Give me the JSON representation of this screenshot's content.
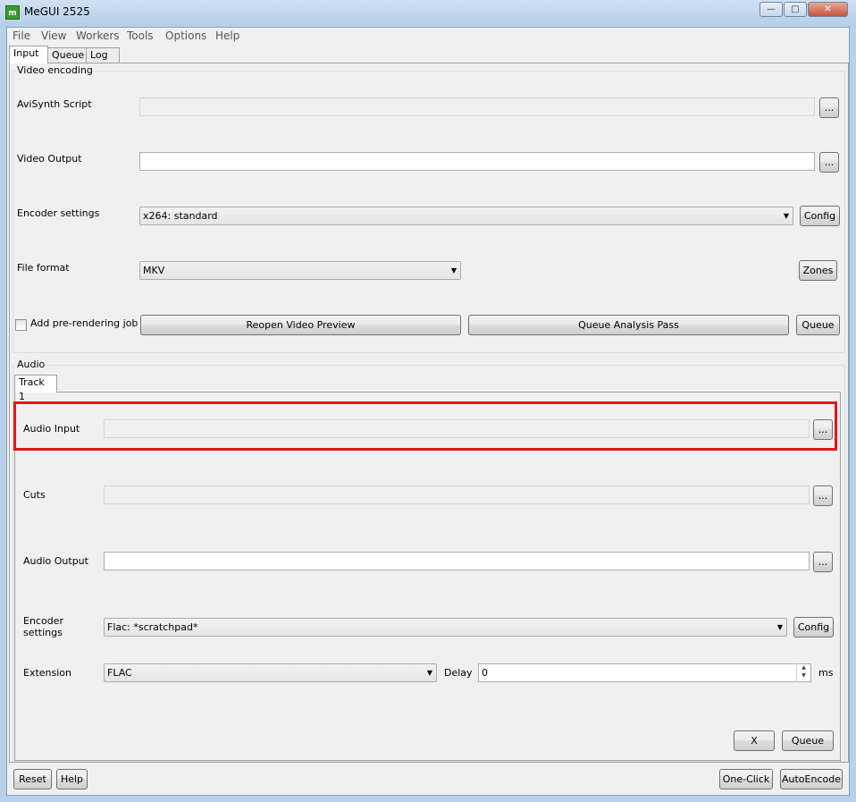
{
  "window": {
    "title": "MeGUI 2525",
    "icon_text": "m"
  },
  "menu": [
    "File",
    "View",
    "Workers",
    "Tools",
    "Options",
    "Help"
  ],
  "tabs": [
    "Input",
    "Queue",
    "Log"
  ],
  "video": {
    "group_title": "Video encoding",
    "avisynth_label": "AviSynth Script",
    "avisynth_value": "",
    "video_output_label": "Video Output",
    "video_output_value": "",
    "encoder_label": "Encoder settings",
    "encoder_value": "x264: standard",
    "file_format_label": "File format",
    "file_format_value": "MKV",
    "prerender_label": "Add pre-rendering job",
    "prerender_checked": false,
    "browse": "...",
    "config": "Config",
    "zones": "Zones",
    "reopen_preview": "Reopen Video Preview",
    "queue_analysis": "Queue Analysis Pass",
    "queue": "Queue"
  },
  "audio": {
    "group_title": "Audio",
    "track_tab": "Track 1",
    "audio_input_label": "Audio Input",
    "audio_input_value": "",
    "cuts_label": "Cuts",
    "cuts_value": "",
    "audio_output_label": "Audio Output",
    "audio_output_value": "",
    "encoder_label_1": "Encoder",
    "encoder_label_2": "settings",
    "encoder_value": "Flac: *scratchpad*",
    "extension_label": "Extension",
    "extension_value": "FLAC",
    "delay_label": "Delay",
    "delay_value": "0",
    "delay_unit": "ms",
    "browse": "...",
    "config": "Config",
    "x": "X",
    "queue": "Queue"
  },
  "footer": {
    "reset": "Reset",
    "help": "Help",
    "one_click": "One-Click",
    "auto_encode": "AutoEncode"
  },
  "colors": {
    "highlight": "#e8131a",
    "titlebar": "#b9d1ea"
  }
}
